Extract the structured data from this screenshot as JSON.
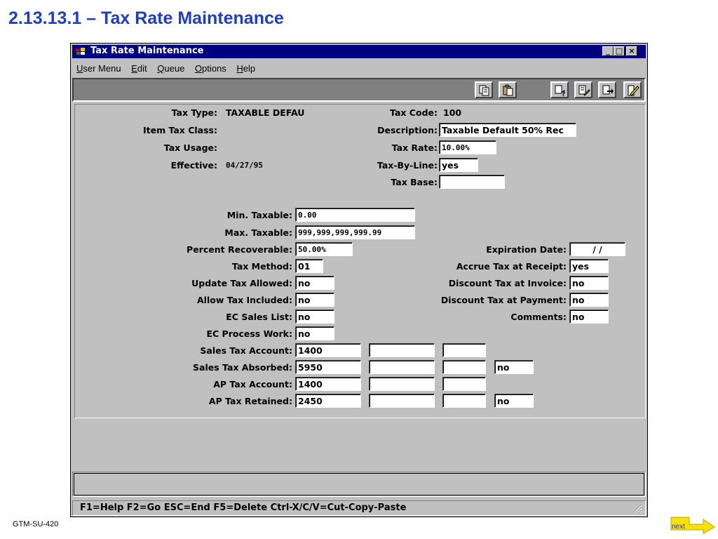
{
  "slide": {
    "title": "2.13.13.1 – Tax Rate Maintenance",
    "footer_code": "GTM-SU-420",
    "next_label": "next"
  },
  "window": {
    "title": "Tax Rate Maintenance",
    "controls": {
      "minimize": "_",
      "maximize": "□",
      "close": "×"
    }
  },
  "menu": [
    {
      "u": "U",
      "rest": "ser Menu"
    },
    {
      "u": "E",
      "rest": "dit"
    },
    {
      "u": "Q",
      "rest": "ueue"
    },
    {
      "u": "O",
      "rest": "ptions"
    },
    {
      "u": "H",
      "rest": "elp"
    }
  ],
  "toolbar_icons": [
    "copy-icon",
    "paste-icon",
    "zoom-help-icon",
    "edit-notes-icon",
    "export-icon",
    "exit-icon"
  ],
  "header_left": {
    "tax_type_label": "Tax Type:",
    "tax_type_value": "TAXABLE DEFAU",
    "item_tax_class_label": "Item Tax Class:",
    "tax_usage_label": "Tax Usage:",
    "effective_label": "Effective:",
    "effective_value": "04/27/95"
  },
  "header_right": {
    "tax_code_label": "Tax Code:",
    "tax_code_value": "100",
    "description_label": "Description:",
    "description_value": "Taxable Default 50% Rec",
    "tax_rate_label": "Tax Rate:",
    "tax_rate_value": "10.00%",
    "tax_by_line_label": "Tax-By-Line:",
    "tax_by_line_value": "yes",
    "tax_base_label": "Tax Base:",
    "tax_base_value": ""
  },
  "form_left": {
    "min_taxable_label": "Min. Taxable:",
    "min_taxable_value": "0.00",
    "max_taxable_label": "Max. Taxable:",
    "max_taxable_value": "999,999,999,999.99",
    "percent_recoverable_label": "Percent Recoverable:",
    "percent_recoverable_value": "50.00%",
    "tax_method_label": "Tax Method:",
    "tax_method_value": "01",
    "update_tax_allowed_label": "Update Tax Allowed:",
    "update_tax_allowed_value": "no",
    "allow_tax_included_label": "Allow Tax Included:",
    "allow_tax_included_value": "no",
    "ec_sales_list_label": "EC Sales List:",
    "ec_sales_list_value": "no",
    "ec_process_work_label": "EC Process Work:",
    "ec_process_work_value": "no"
  },
  "form_right": {
    "expiration_date_label": "Expiration Date:",
    "expiration_date_value": "/ /",
    "accrue_tax_label": "Accrue Tax at Receipt:",
    "accrue_tax_value": "yes",
    "discount_invoice_label": "Discount Tax at Invoice:",
    "discount_invoice_value": "no",
    "discount_payment_label": "Discount Tax at Payment:",
    "discount_payment_value": "no",
    "comments_label": "Comments:",
    "comments_value": "no"
  },
  "accounts": {
    "sales_tax_account_label": "Sales Tax Account:",
    "sales_tax_account_value": "1400",
    "sales_tax_absorbed_label": "Sales Tax Absorbed:",
    "sales_tax_absorbed_value": "5950",
    "sales_tax_absorbed_flag": "no",
    "ap_tax_account_label": "AP Tax Account:",
    "ap_tax_account_value": "1400",
    "ap_tax_retained_label": "AP Tax Retained:",
    "ap_tax_retained_value": "2450",
    "ap_tax_retained_flag": "no"
  },
  "status": {
    "message": "",
    "hotkeys": "F1=Help  F2=Go  ESC=End  F5=Delete  Ctrl-X/C/V=Cut-Copy-Paste"
  },
  "colors": {
    "title_blue": "#1c3ec4",
    "titlebar_navy": "#000080",
    "window_gray": "#c0c0c0",
    "toolbar_dark": "#808080",
    "next_arrow_yellow": "#f5e200"
  }
}
